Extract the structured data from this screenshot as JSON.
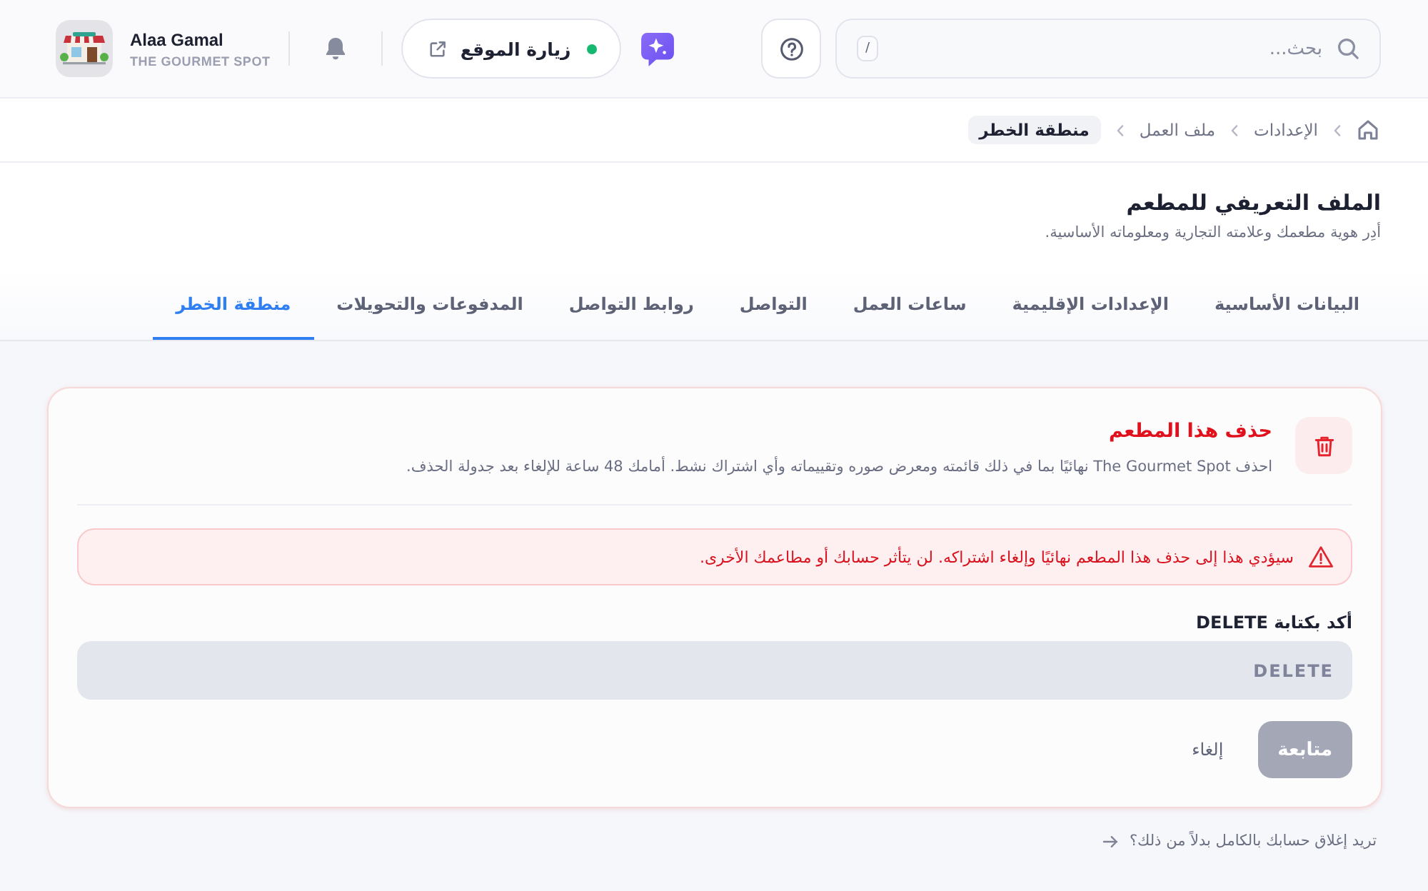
{
  "top_bar": {
    "search": {
      "placeholder": "بحث...",
      "shortcut": "/"
    },
    "visit_site": {
      "label": "زيارة الموقع",
      "live": true
    },
    "user": {
      "name": "Alaa Gamal",
      "restaurant": "THE GOURMET SPOT"
    }
  },
  "breadcrumb": [
    {
      "label": "الإعدادات",
      "current": false
    },
    {
      "label": "ملف العمل",
      "current": false
    },
    {
      "label": "منطقة الخطر",
      "current": true
    }
  ],
  "page": {
    "title": "الملف التعريفي للمطعم",
    "subtitle": "أدِر هوية مطعمك وعلامته التجارية ومعلوماته الأساسية."
  },
  "tabs": [
    {
      "label": "البيانات الأساسية",
      "selected": false
    },
    {
      "label": "الإعدادات الإقليمية",
      "selected": false
    },
    {
      "label": "ساعات العمل",
      "selected": false
    },
    {
      "label": "التواصل",
      "selected": false
    },
    {
      "label": "روابط التواصل",
      "selected": false
    },
    {
      "label": "المدفوعات والتحويلات",
      "selected": false
    },
    {
      "label": "منطقة الخطر",
      "selected": true
    }
  ],
  "danger_card": {
    "title": "حذف هذا المطعم",
    "description": "احذف The Gourmet Spot نهائيًا بما في ذلك قائمته ومعرض صوره وتقييماته وأي اشتراك نشط. أمامك 48 ساعة للإلغاء بعد جدولة الحذف.",
    "warning": "سيؤدي هذا إلى حذف هذا المطعم نهائيًا وإلغاء اشتراكه. لن يتأثر حسابك أو مطاعمك الأخرى.",
    "confirm_label": "أكد بكتابة DELETE",
    "confirm_field": {
      "placeholder": "DELETE"
    },
    "buttons": [
      {
        "label": "متابعة",
        "kind": "primary",
        "disabled": true
      },
      {
        "label": "إلغاء",
        "kind": "link",
        "disabled": false
      }
    ]
  },
  "footer_link": "تريد إغلاق حسابك بالكامل بدلاً من ذلك؟"
}
